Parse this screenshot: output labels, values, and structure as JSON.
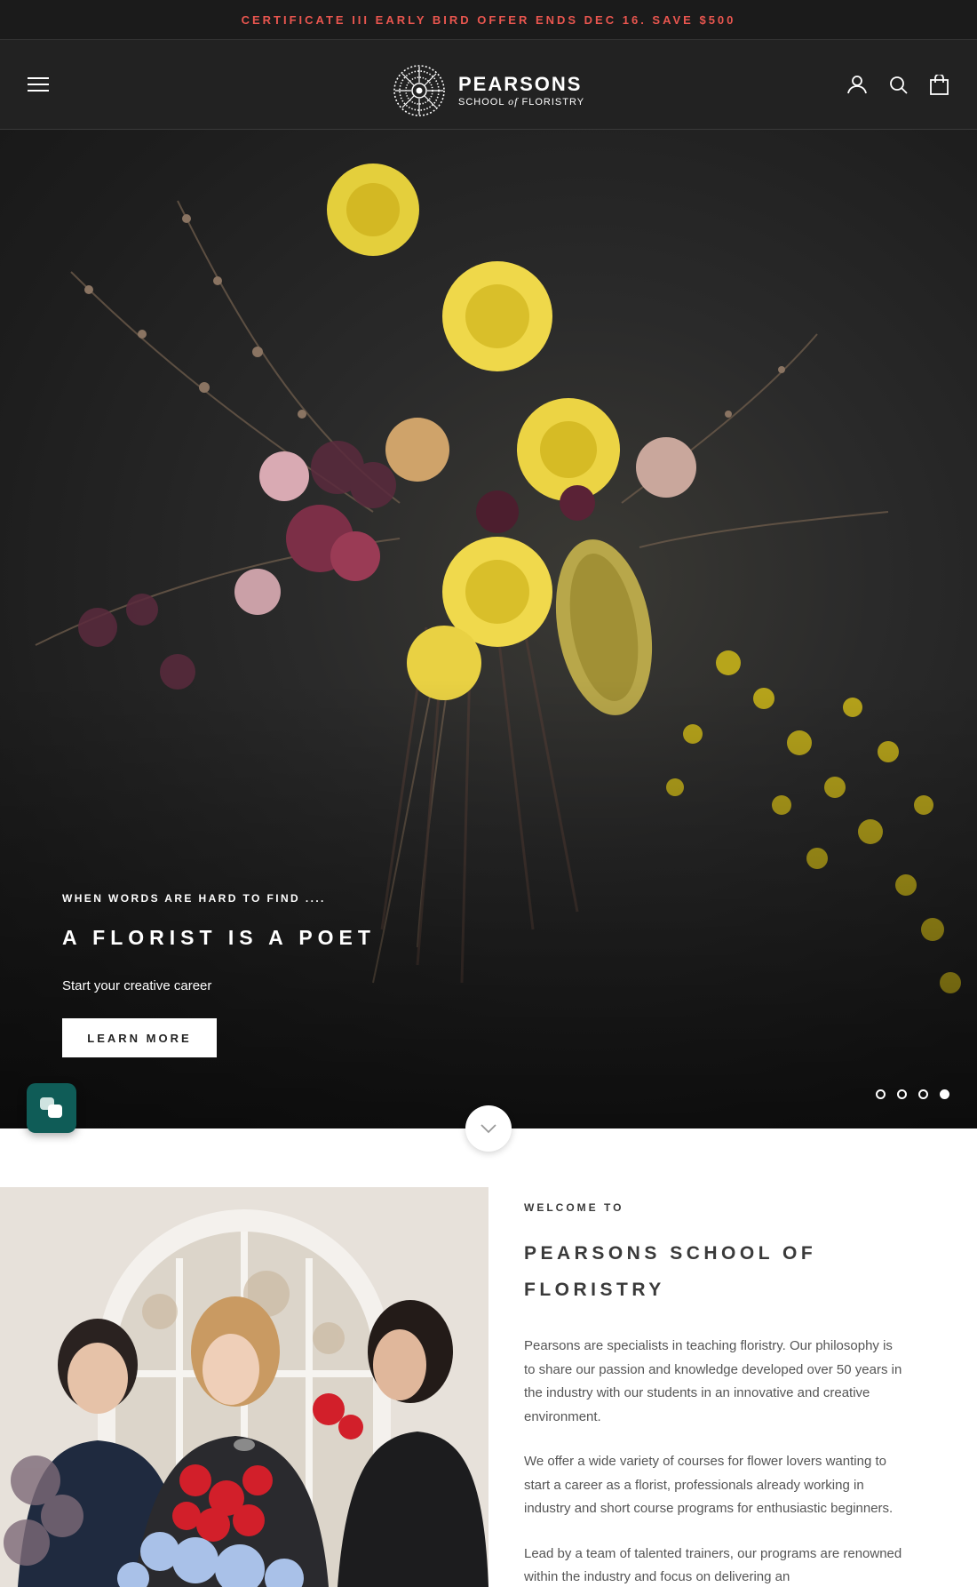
{
  "announcement": {
    "text": "CERTIFICATE III EARLY BIRD OFFER ENDS DEC 16. SAVE $500"
  },
  "header": {
    "menu_icon": "hamburger-menu-icon",
    "logo": {
      "main": "PEARSONS",
      "sub_pre": "SCHOOL",
      "sub_of": "of",
      "sub_post": "FLORISTRY"
    },
    "icons": [
      "account-icon",
      "search-icon",
      "cart-icon"
    ]
  },
  "hero": {
    "subheading": "WHEN WORDS ARE HARD TO FIND ....",
    "heading": "A FLORIST IS A POET",
    "text": "Start your creative career",
    "button": "LEARN MORE",
    "slides": 4,
    "active_slide": 4
  },
  "welcome": {
    "kicker": "WELCOME TO",
    "title": "PEARSONS SCHOOL OF FLORISTRY",
    "paragraphs": [
      "Pearsons are specialists in teaching floristry. Our philosophy is to share our passion and knowledge developed over 50 years in the industry with our students in an innovative and creative environment.",
      "We offer a wide variety of courses for flower lovers wanting to start a career as a florist, professionals already working in industry and short course programs for enthusiastic beginners.",
      "Lead by a team of talented trainers, our programs are renowned within the industry and focus on delivering an"
    ]
  },
  "colors": {
    "accent": "#e9564f",
    "chat": "#0f5c57",
    "dark": "#1b1b1b"
  }
}
